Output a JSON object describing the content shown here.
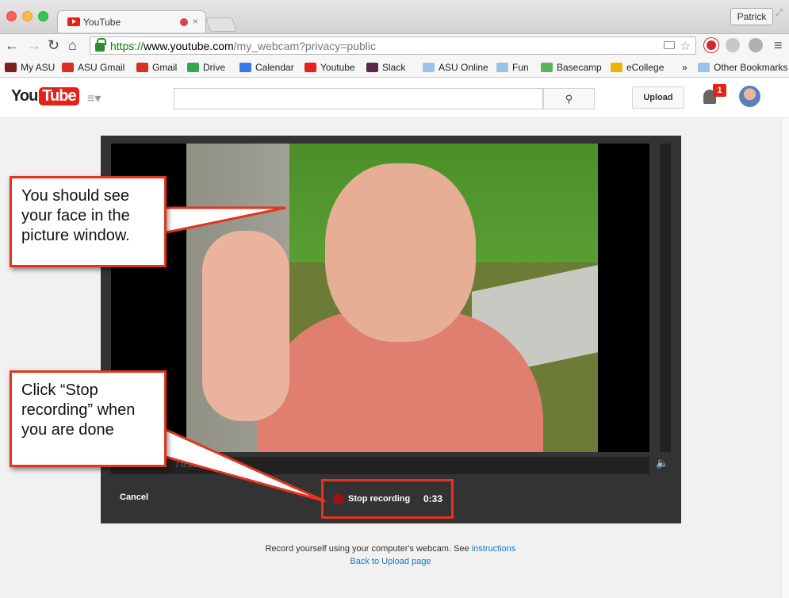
{
  "browser": {
    "tab_title": "YouTube",
    "tab_close": "×",
    "profile_name": "Patrick",
    "url_scheme": "https://",
    "url_host": "www.youtube.com",
    "url_path": "/my_webcam?privacy=public",
    "bookmarks": [
      {
        "label": "My ASU",
        "icon": "asu-icon",
        "color": "#7a1f1f"
      },
      {
        "label": "ASU Gmail",
        "icon": "gmail-icon",
        "color": "#d93025"
      },
      {
        "label": "Gmail",
        "icon": "gmail-icon",
        "color": "#d93025"
      },
      {
        "label": "Drive",
        "icon": "drive-icon",
        "color": "#2fa84f"
      },
      {
        "label": "Calendar",
        "icon": "calendar-icon",
        "color": "#3b78e7"
      },
      {
        "label": "Youtube",
        "icon": "youtube-icon",
        "color": "#e62117"
      },
      {
        "label": "Slack",
        "icon": "slack-icon",
        "color": "#5a2a4a"
      },
      {
        "label": "ASU Online",
        "icon": "folder-icon",
        "color": "#9cc3e5"
      },
      {
        "label": "Fun",
        "icon": "folder-icon",
        "color": "#9cc3e5"
      },
      {
        "label": "Basecamp",
        "icon": "basecamp-icon",
        "color": "#5ab55a"
      },
      {
        "label": "eCollege",
        "icon": "ecollege-icon",
        "color": "#f0b400"
      }
    ],
    "overflow_chevron": "»",
    "other_bookmarks": "Other Bookmarks"
  },
  "youtube": {
    "logo_you": "You",
    "logo_tube": "Tube",
    "search_placeholder": "",
    "upload_label": "Upload",
    "notification_count": "1"
  },
  "recorder": {
    "time_display": "/ 0:33",
    "cancel_label": "Cancel",
    "stop_label": "Stop recording",
    "elapsed": "0:33"
  },
  "footer": {
    "text": "Record yourself using your computer's webcam. See",
    "instructions_link": "instructions",
    "back_link": "Back to Upload page"
  },
  "callouts": {
    "face": "You should see your face in the picture window.",
    "stop": "Click “Stop recording” when you are done"
  },
  "colors": {
    "callout_border": "#e4341e",
    "youtube_red": "#e62117",
    "link_blue": "#167ac6"
  }
}
